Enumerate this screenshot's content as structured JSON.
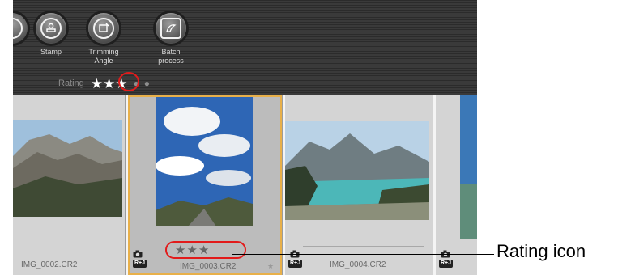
{
  "toolbar": {
    "tools": [
      {
        "label": "Stamp",
        "icon": "stamp-icon"
      },
      {
        "label": "Trimming\nAngle",
        "icon": "trimming-angle-icon"
      },
      {
        "label": "Batch\nprocess",
        "icon": "batch-process-icon"
      }
    ],
    "rating": {
      "label": "Rating",
      "stars": "★★★",
      "value": 3,
      "max": 5
    }
  },
  "thumbnails": [
    {
      "filename": "IMG_0002.CR2",
      "badge": "R+J"
    },
    {
      "filename": "IMG_0003.CR2",
      "badge": "R+J",
      "stars": "★★★",
      "selected": true
    },
    {
      "filename": "IMG_0004.CR2",
      "badge": "R+J"
    },
    {
      "badge": "R+J"
    }
  ],
  "callout": {
    "text": "Rating icon"
  },
  "colors": {
    "highlight": "#e21b1b",
    "selection": "#e8b04a",
    "toolbar": "#2b2b2b"
  }
}
